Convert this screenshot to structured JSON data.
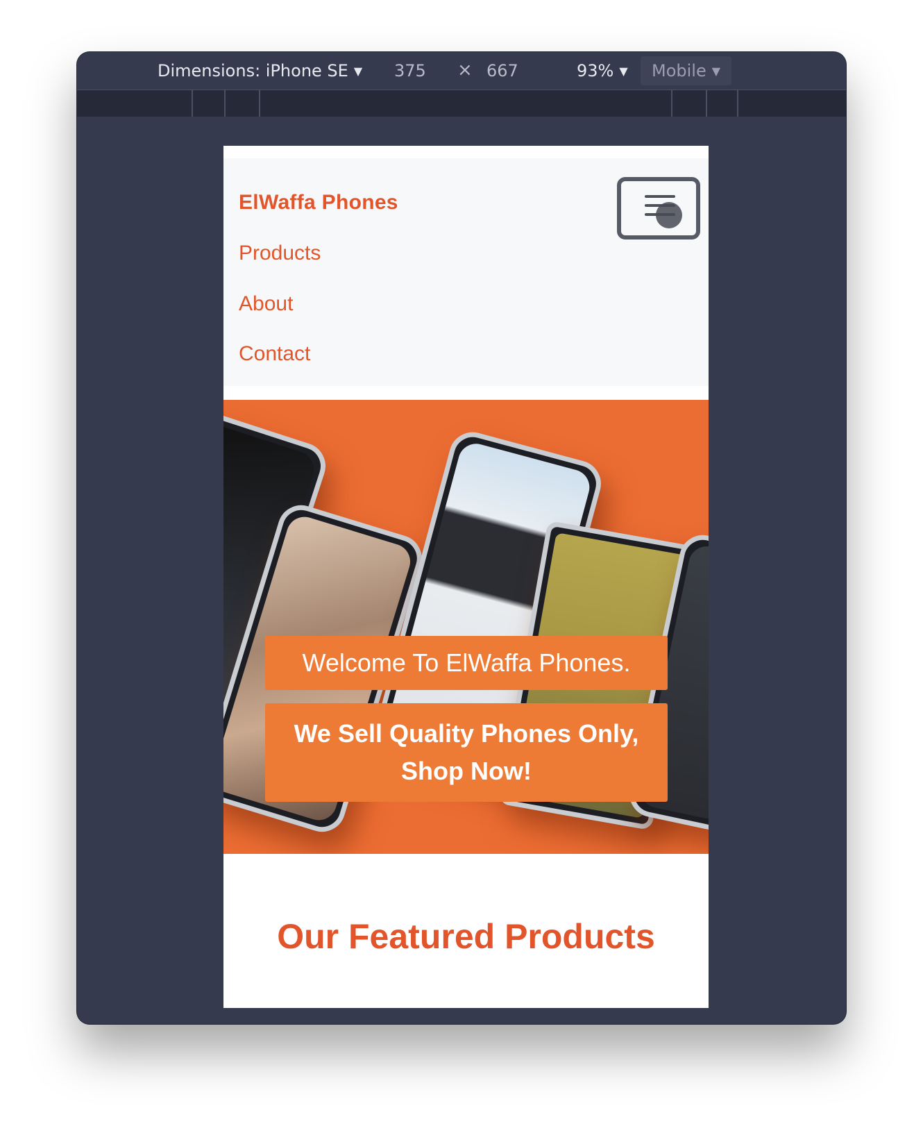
{
  "devtools": {
    "dimensions_label": "Dimensions: iPhone SE",
    "width": "375",
    "times": "×",
    "height": "667",
    "zoom": "93%",
    "mode": "Mobile",
    "caret": "▼"
  },
  "site": {
    "brand": "ElWaffa Phones",
    "nav": [
      "Products",
      "About",
      "Contact"
    ],
    "hero_line1": "Welcome To ElWaffa Phones.",
    "hero_line2": "We Sell Quality Phones Only, Shop Now!",
    "featured_heading": "Our Featured Products"
  },
  "colors": {
    "accent": "#e2552b",
    "hero_bg": "#ec6d33",
    "caption_bg": "#ed7a35",
    "devtools_bg": "#363a4f"
  }
}
